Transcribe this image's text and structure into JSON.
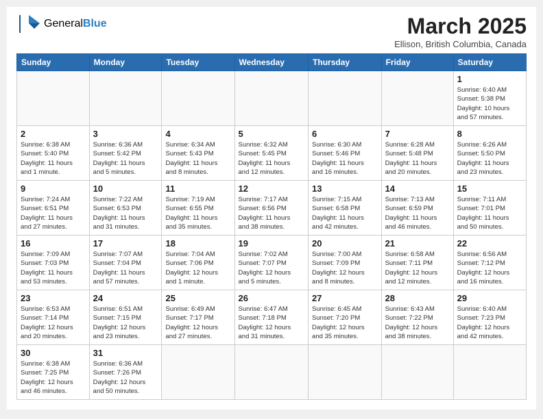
{
  "header": {
    "logo_general": "General",
    "logo_blue": "Blue",
    "month_title": "March 2025",
    "location": "Ellison, British Columbia, Canada"
  },
  "days_of_week": [
    "Sunday",
    "Monday",
    "Tuesday",
    "Wednesday",
    "Thursday",
    "Friday",
    "Saturday"
  ],
  "weeks": [
    [
      {
        "num": "",
        "info": ""
      },
      {
        "num": "",
        "info": ""
      },
      {
        "num": "",
        "info": ""
      },
      {
        "num": "",
        "info": ""
      },
      {
        "num": "",
        "info": ""
      },
      {
        "num": "",
        "info": ""
      },
      {
        "num": "1",
        "info": "Sunrise: 6:40 AM\nSunset: 5:38 PM\nDaylight: 10 hours\nand 57 minutes."
      }
    ],
    [
      {
        "num": "2",
        "info": "Sunrise: 6:38 AM\nSunset: 5:40 PM\nDaylight: 11 hours\nand 1 minute."
      },
      {
        "num": "3",
        "info": "Sunrise: 6:36 AM\nSunset: 5:42 PM\nDaylight: 11 hours\nand 5 minutes."
      },
      {
        "num": "4",
        "info": "Sunrise: 6:34 AM\nSunset: 5:43 PM\nDaylight: 11 hours\nand 8 minutes."
      },
      {
        "num": "5",
        "info": "Sunrise: 6:32 AM\nSunset: 5:45 PM\nDaylight: 11 hours\nand 12 minutes."
      },
      {
        "num": "6",
        "info": "Sunrise: 6:30 AM\nSunset: 5:46 PM\nDaylight: 11 hours\nand 16 minutes."
      },
      {
        "num": "7",
        "info": "Sunrise: 6:28 AM\nSunset: 5:48 PM\nDaylight: 11 hours\nand 20 minutes."
      },
      {
        "num": "8",
        "info": "Sunrise: 6:26 AM\nSunset: 5:50 PM\nDaylight: 11 hours\nand 23 minutes."
      }
    ],
    [
      {
        "num": "9",
        "info": "Sunrise: 7:24 AM\nSunset: 6:51 PM\nDaylight: 11 hours\nand 27 minutes."
      },
      {
        "num": "10",
        "info": "Sunrise: 7:22 AM\nSunset: 6:53 PM\nDaylight: 11 hours\nand 31 minutes."
      },
      {
        "num": "11",
        "info": "Sunrise: 7:19 AM\nSunset: 6:55 PM\nDaylight: 11 hours\nand 35 minutes."
      },
      {
        "num": "12",
        "info": "Sunrise: 7:17 AM\nSunset: 6:56 PM\nDaylight: 11 hours\nand 38 minutes."
      },
      {
        "num": "13",
        "info": "Sunrise: 7:15 AM\nSunset: 6:58 PM\nDaylight: 11 hours\nand 42 minutes."
      },
      {
        "num": "14",
        "info": "Sunrise: 7:13 AM\nSunset: 6:59 PM\nDaylight: 11 hours\nand 46 minutes."
      },
      {
        "num": "15",
        "info": "Sunrise: 7:11 AM\nSunset: 7:01 PM\nDaylight: 11 hours\nand 50 minutes."
      }
    ],
    [
      {
        "num": "16",
        "info": "Sunrise: 7:09 AM\nSunset: 7:03 PM\nDaylight: 11 hours\nand 53 minutes."
      },
      {
        "num": "17",
        "info": "Sunrise: 7:07 AM\nSunset: 7:04 PM\nDaylight: 11 hours\nand 57 minutes."
      },
      {
        "num": "18",
        "info": "Sunrise: 7:04 AM\nSunset: 7:06 PM\nDaylight: 12 hours\nand 1 minute."
      },
      {
        "num": "19",
        "info": "Sunrise: 7:02 AM\nSunset: 7:07 PM\nDaylight: 12 hours\nand 5 minutes."
      },
      {
        "num": "20",
        "info": "Sunrise: 7:00 AM\nSunset: 7:09 PM\nDaylight: 12 hours\nand 8 minutes."
      },
      {
        "num": "21",
        "info": "Sunrise: 6:58 AM\nSunset: 7:11 PM\nDaylight: 12 hours\nand 12 minutes."
      },
      {
        "num": "22",
        "info": "Sunrise: 6:56 AM\nSunset: 7:12 PM\nDaylight: 12 hours\nand 16 minutes."
      }
    ],
    [
      {
        "num": "23",
        "info": "Sunrise: 6:53 AM\nSunset: 7:14 PM\nDaylight: 12 hours\nand 20 minutes."
      },
      {
        "num": "24",
        "info": "Sunrise: 6:51 AM\nSunset: 7:15 PM\nDaylight: 12 hours\nand 23 minutes."
      },
      {
        "num": "25",
        "info": "Sunrise: 6:49 AM\nSunset: 7:17 PM\nDaylight: 12 hours\nand 27 minutes."
      },
      {
        "num": "26",
        "info": "Sunrise: 6:47 AM\nSunset: 7:18 PM\nDaylight: 12 hours\nand 31 minutes."
      },
      {
        "num": "27",
        "info": "Sunrise: 6:45 AM\nSunset: 7:20 PM\nDaylight: 12 hours\nand 35 minutes."
      },
      {
        "num": "28",
        "info": "Sunrise: 6:43 AM\nSunset: 7:22 PM\nDaylight: 12 hours\nand 38 minutes."
      },
      {
        "num": "29",
        "info": "Sunrise: 6:40 AM\nSunset: 7:23 PM\nDaylight: 12 hours\nand 42 minutes."
      }
    ],
    [
      {
        "num": "30",
        "info": "Sunrise: 6:38 AM\nSunset: 7:25 PM\nDaylight: 12 hours\nand 46 minutes."
      },
      {
        "num": "31",
        "info": "Sunrise: 6:36 AM\nSunset: 7:26 PM\nDaylight: 12 hours\nand 50 minutes."
      },
      {
        "num": "",
        "info": ""
      },
      {
        "num": "",
        "info": ""
      },
      {
        "num": "",
        "info": ""
      },
      {
        "num": "",
        "info": ""
      },
      {
        "num": "",
        "info": ""
      }
    ]
  ]
}
